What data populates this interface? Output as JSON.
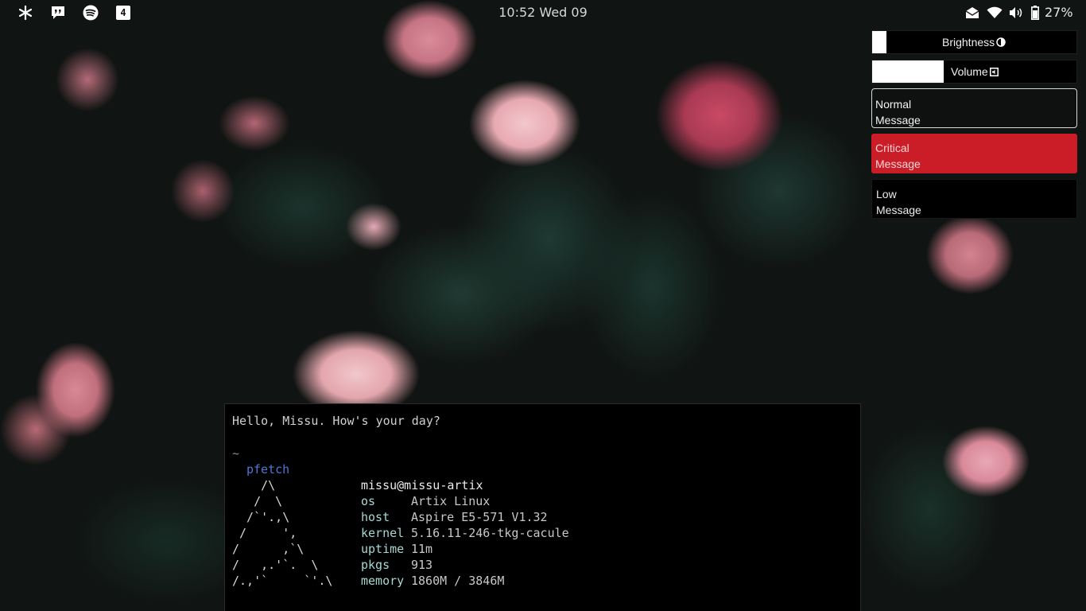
{
  "topbar": {
    "left_icons": [
      "asterisk-icon",
      "chat-quote-icon",
      "spotify-icon",
      "workspace-4-icon"
    ],
    "workspace_label": "4",
    "clock": "10:52 Wed 09",
    "right_icons": [
      "mail-icon",
      "wifi-icon",
      "volume-icon",
      "battery-icon"
    ],
    "battery_percent": "27%"
  },
  "osd": {
    "brightness": {
      "label": "Brightness",
      "level": 0.07
    },
    "volume": {
      "label": "Volume",
      "level": 0.35
    }
  },
  "notifications": [
    {
      "urgency": "normal",
      "title": "Normal",
      "body": "Message"
    },
    {
      "urgency": "critical",
      "title": "Critical",
      "body": "Message",
      "color": "#d71e28"
    },
    {
      "urgency": "low",
      "title": "Low",
      "body": "Message"
    }
  ],
  "terminal": {
    "greeting": "Hello, Missu. How's your day?",
    "prompt": "~",
    "command": "pfetch",
    "ascii_art": "    /\\\n   /  \\\n  /`'.,\\\n /     ',\n/      ,`\\\n/   ,.'`.  \\\n/.,'`     `'.\\",
    "user_host": "missu@missu-artix",
    "info": [
      {
        "key": "os",
        "value": "Artix Linux"
      },
      {
        "key": "host",
        "value": "Aspire E5-571 V1.32"
      },
      {
        "key": "kernel",
        "value": "5.16.11-246-tkg-cacule"
      },
      {
        "key": "uptime",
        "value": "11m"
      },
      {
        "key": "pkgs",
        "value": "913"
      },
      {
        "key": "memory",
        "value": "1860M / 3846M"
      }
    ],
    "colors": {
      "command": "#4c78d6",
      "keys": "#a6d8d2"
    }
  }
}
